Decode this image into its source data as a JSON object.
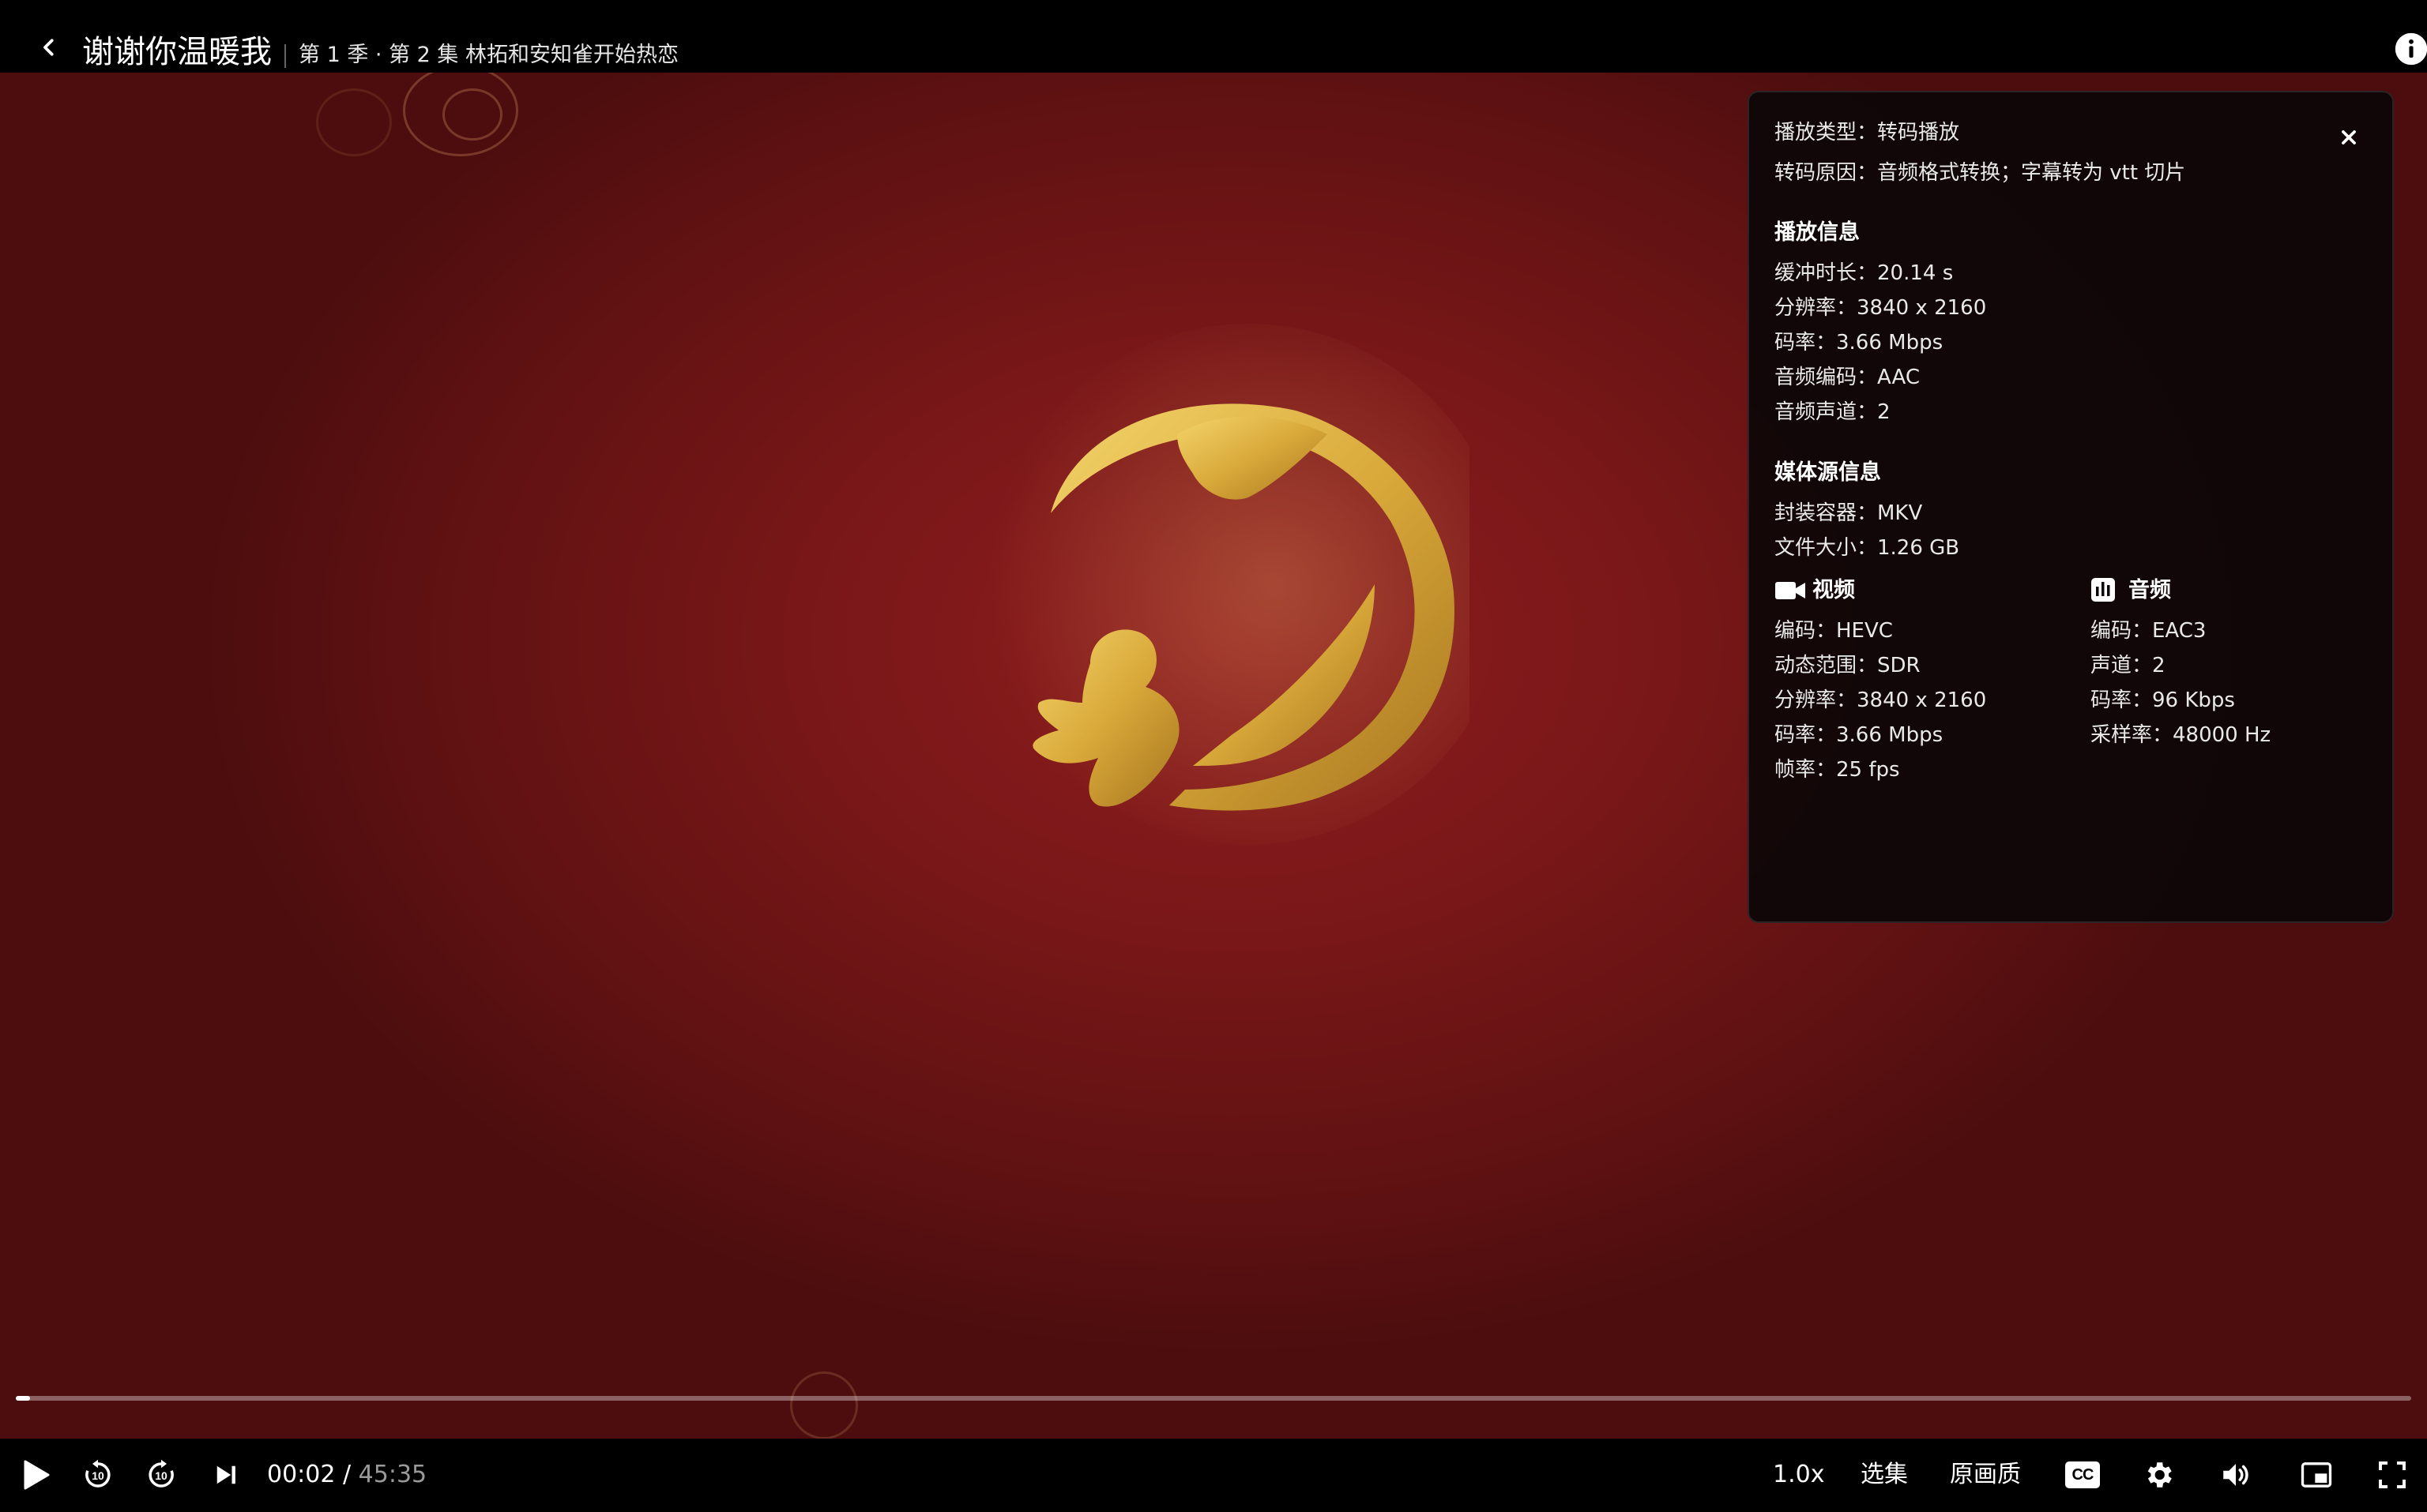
{
  "header": {
    "show_title": "谢谢你温暖我",
    "episode_title": "第 1 季 · 第 2 集 林拓和安知雀开始热恋"
  },
  "info_panel": {
    "play_type": "播放类型：转码播放",
    "transcode_reason": "转码原因：音频格式转换；字幕转为 vtt 切片",
    "playback": {
      "heading": "播放信息",
      "buffer": "缓冲时长：20.14 s",
      "resolution": "分辨率：3840 x 2160",
      "bitrate": "码率：3.66 Mbps",
      "audio_codec": "音频编码：AAC",
      "audio_channels": "音频声道：2"
    },
    "media_source": {
      "heading": "媒体源信息",
      "container": "封装容器：MKV",
      "file_size": "文件大小：1.26 GB"
    },
    "video": {
      "heading": "视频",
      "codec": "编码：HEVC",
      "dynamic_range": "动态范围：SDR",
      "resolution": "分辨率：3840 x 2160",
      "bitrate": "码率：3.66 Mbps",
      "framerate": "帧率：25 fps"
    },
    "audio": {
      "heading": "音频",
      "codec": "编码：EAC3",
      "channels": "声道：2",
      "bitrate": "码率：96 Kbps",
      "sample_rate": "采样率：48000 Hz"
    }
  },
  "player": {
    "current_time": "00:02",
    "separator": " / ",
    "duration": "45:35",
    "progress_fraction": 0.0007,
    "speed": "1.0x",
    "episodes": "选集",
    "quality": "原画质",
    "cc_label": "CC"
  },
  "icons": {
    "back": "chevron-left-icon",
    "info": "info-icon",
    "close": "close-icon",
    "play": "play-icon",
    "rewind": "rewind-10-icon",
    "forward": "forward-10-icon",
    "next": "skip-next-icon",
    "settings": "gear-icon",
    "volume": "volume-icon",
    "pip": "picture-in-picture-icon",
    "fullscreen": "fullscreen-icon"
  },
  "colors": {
    "video_bg": "#7a1718",
    "logo_gold": "#d9a93a",
    "panel_bg": "#0c0608"
  }
}
